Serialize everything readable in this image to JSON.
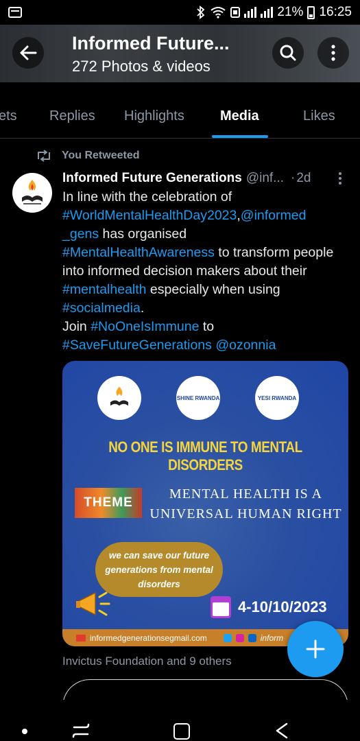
{
  "status_bar": {
    "battery": "21%",
    "time": "16:25"
  },
  "header": {
    "title": "Informed Future...",
    "subtitle": "272 Photos & videos"
  },
  "tabs": [
    {
      "label": "ets",
      "active": false
    },
    {
      "label": "Replies",
      "active": false
    },
    {
      "label": "Highlights",
      "active": false
    },
    {
      "label": "Media",
      "active": true
    },
    {
      "label": "Likes",
      "active": false
    }
  ],
  "tweet": {
    "retweet_label": "You Retweeted",
    "author_name": "Informed Future Generations",
    "handle": "@inf...",
    "dot": "·",
    "date": "2d",
    "body": {
      "t1": "In line with the celebration of ",
      "h1": "#WorldMentalHealthDay2023",
      "t2": ",",
      "h2": "@informed _gens",
      "t3": " has organised ",
      "h3": "#MentalHealthAwareness",
      "t4": " to transform people into informed decision makers about their ",
      "h4": "#mentalhealth",
      "t5": " especially when using ",
      "h5": "#socialmedia",
      "t6": ".",
      "t7": "Join ",
      "h6": "#NoOneIsImmune",
      "t8": " to",
      "h7": "#SaveFutureGenerations",
      "h8": "@ozonnia"
    },
    "liked_by": "Invictus Foundation and 9 others"
  },
  "media": {
    "logo2_text": "SHINE RWANDA",
    "logo3_text": "YESI RWANDA",
    "headline": "NO ONE IS IMMUNE TO MENTAL DISORDERS",
    "theme_label": "THEME",
    "theme_line1": "MENTAL HEALTH IS A",
    "theme_line2": "UNIVERSAL HUMAN RIGHT",
    "bubble_text": "we can save our future generations from mental disorders",
    "date_range": "4-10/10/2023",
    "email": "informedgenerationsegmail.com",
    "footer_handle": "inform"
  },
  "colors": {
    "accent": "#1d9bf0",
    "background": "#000000",
    "muted_text": "#8b98a5",
    "poster_blue": "#2a4fa2",
    "poster_yellow": "#f6d53c"
  }
}
